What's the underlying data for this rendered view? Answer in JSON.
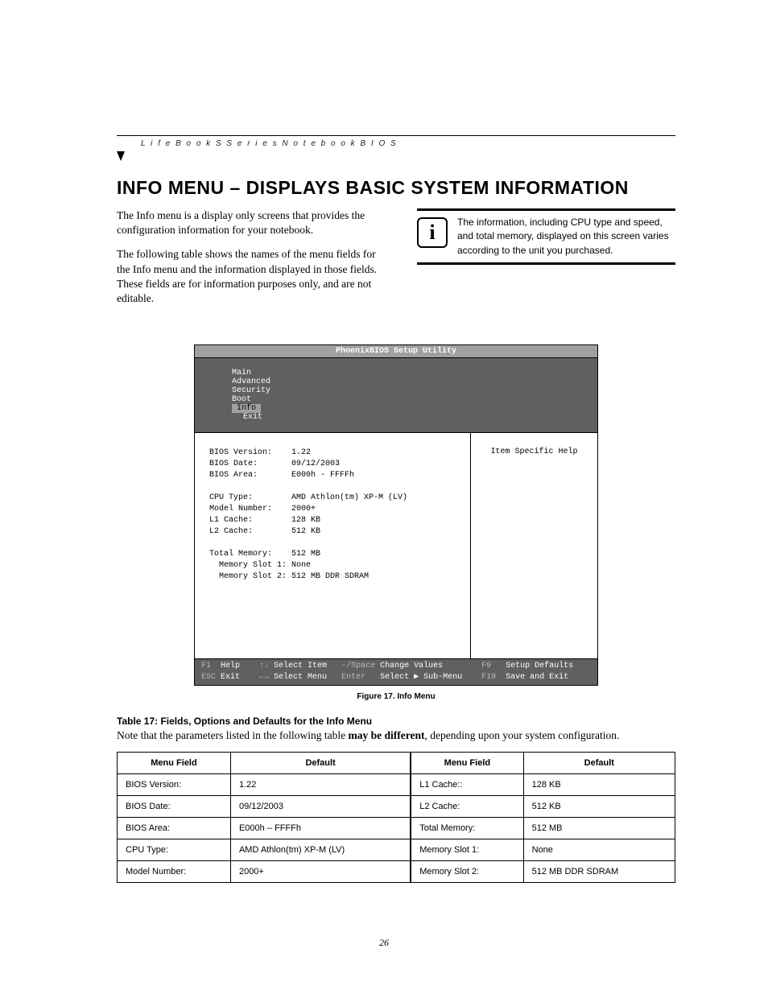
{
  "header": {
    "text": "L i f e B o o k  S  S e r i e s  N o t e b o o k  B I O S"
  },
  "title": "INFO MENU – DISPLAYS BASIC SYSTEM INFORMATION",
  "paragraphs": {
    "p1": "The Info menu is a display only screens that provides the configuration information for your notebook.",
    "p2_a": "The following table shows the names of the menu fields for the Info menu and the information displayed in those fields. These fields are for information purposes only, and are not editable",
    "p2_dot": "."
  },
  "info_blurb": "The information, including CPU type and speed, and total memory, displayed on this screen varies according to the unit you purchased.",
  "bios": {
    "title": "PhoenixBIOS Setup Utility",
    "tabs": [
      "Main",
      "Advanced",
      "Security",
      "Boot",
      "Info",
      "Exit"
    ],
    "active_tab_index": 4,
    "help_title": "Item Specific Help",
    "rows": [
      {
        "label": "BIOS Version:",
        "value": "1.22"
      },
      {
        "label": "BIOS Date:",
        "value": "09/12/2003"
      },
      {
        "label": "BIOS Area:",
        "value": "E000h - FFFFh"
      },
      {
        "label": "",
        "value": ""
      },
      {
        "label": "CPU Type:",
        "value": "AMD Athlon(tm) XP-M (LV)"
      },
      {
        "label": "Model Number:",
        "value": "2000+"
      },
      {
        "label": "L1 Cache:",
        "value": "128 KB"
      },
      {
        "label": "L2 Cache:",
        "value": "512 KB"
      },
      {
        "label": "",
        "value": ""
      },
      {
        "label": "Total Memory:",
        "value": "512 MB"
      },
      {
        "label": "  Memory Slot 1:",
        "value": "None"
      },
      {
        "label": "  Memory Slot 2:",
        "value": "512 MB DDR SDRAM"
      }
    ],
    "footer": {
      "l1a": "F1",
      "l1b": "Help",
      "l1c": "↑↓",
      "l1d": "Select Item",
      "l1e": "-/Space",
      "l1f": "Change Values",
      "l1g": "F9",
      "l1h": "Setup Defaults",
      "l2a": "ESC",
      "l2b": "Exit",
      "l2c": "←→",
      "l2d": "Select Menu",
      "l2e": "Enter",
      "l2f": "Select ▶ Sub-Menu",
      "l2g": "F10",
      "l2h": "Save and Exit"
    }
  },
  "figure_caption": "Figure 17.   Info Menu",
  "table_title": "Table 17: Fields, Options and Defaults for the Info Menu",
  "note_a": "Note that the parameters listed in the following table ",
  "note_b": "may be different",
  "note_c": ", depending upon your system configuration.",
  "table": {
    "headers": [
      "Menu Field",
      "Default",
      "Menu Field",
      "Default"
    ],
    "rows": [
      [
        "BIOS Version:",
        "1.22",
        "L1 Cache::",
        "128 KB"
      ],
      [
        "BIOS Date:",
        "09/12/2003",
        "L2 Cache:",
        "512 KB"
      ],
      [
        "BIOS Area:",
        "E000h – FFFFh",
        "Total Memory:",
        "512 MB"
      ],
      [
        "CPU Type:",
        "AMD Athlon(tm) XP-M (LV)",
        "Memory Slot 1:",
        "None"
      ],
      [
        "Model Number:",
        "2000+",
        "Memory Slot 2:",
        "512 MB DDR SDRAM"
      ]
    ]
  },
  "page_number": "26"
}
